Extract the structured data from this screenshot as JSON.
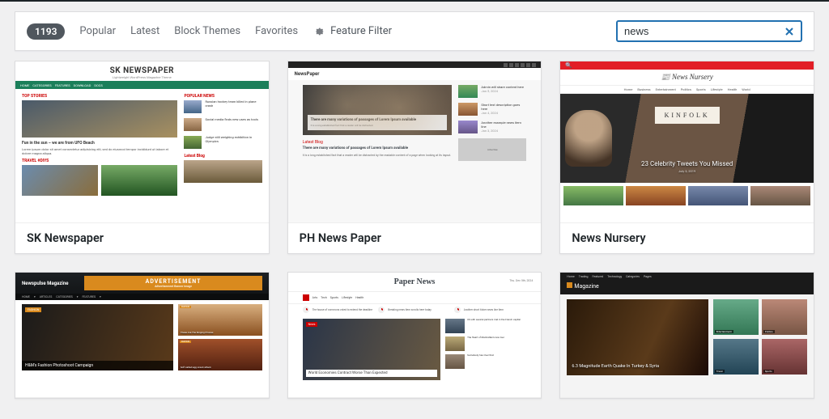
{
  "filter": {
    "count": "1193",
    "popular": "Popular",
    "latest": "Latest",
    "block_themes": "Block Themes",
    "favorites": "Favorites",
    "feature_filter": "Feature Filter"
  },
  "search": {
    "value": "news"
  },
  "themes": [
    {
      "name": "SK Newspaper"
    },
    {
      "name": "PH News Paper"
    },
    {
      "name": "News Nursery"
    },
    {
      "name": ""
    },
    {
      "name": ""
    },
    {
      "name": ""
    }
  ],
  "thumb1": {
    "logo": "SK NEWSPAPER",
    "tagline": "Lightweight WordPress Magazine Theme",
    "top_stories": "TOP STORIES",
    "headline": "Fun in the sun – we are from UFO Beach",
    "popular": "POPULAR NEWS",
    "side1": "Russian hockey team killed in plane crash",
    "side2": "Social media finds new uses as tools",
    "side3": "Judge still weighing exhibition in Olympics"
  },
  "thumb2": {
    "brand": "NewsPaper",
    "overlay_title": "There are many variations of passages of Lorem Ipsum available",
    "latest": "Latest Blog",
    "par": "There are many variations of passages of Lorem Ipsum available"
  },
  "thumb3": {
    "brand": "News Nursery",
    "nav": [
      "Home",
      "Business",
      "Entertainment",
      "Politics",
      "Sports",
      "Lifestyle",
      "Health",
      "World"
    ],
    "kinfolk": "KINFOLK",
    "caption": "23 Celebrity Tweets You Missed",
    "date": "July 3, 2019"
  },
  "thumb4": {
    "logo": "Newspulse Magazine",
    "ad": "ADVERTISEMENT",
    "adsub": "Advertisement Banner Image",
    "nav": [
      "HOME",
      "ARTICLES",
      "CATEGORIES",
      "FEATURES"
    ],
    "tag": "FASHION",
    "hero_cap": "H&M's Fashion Photoshoot Campaign",
    "r1": "These Are The Singing Phones",
    "r2": "Soft salted egg snack attack"
  },
  "thumb5": {
    "title": "Paper News",
    "date": "Thu. Dec 5th, 2024",
    "nav": [
      "Arts",
      "Tech",
      "Sports",
      "Lifestyle",
      "Health"
    ],
    "hero_tag": "News",
    "hero_cap": "World Economies Contract Worse Than Expected",
    "t1": "The house of commons voted to extend the deadline",
    "s1": "US with several partners met in the French capital",
    "s2": "The Heart of Manhattan's new tour",
    "s3": "Somebody has Over that"
  },
  "thumb6": {
    "nav": [
      "Home",
      "Trading",
      "Featured",
      "Technology",
      "Categories",
      "Pages"
    ],
    "logo": "Magazine",
    "hero": "6.3 Magnitude Earth Quake In Turkey & Syria",
    "c1": "Entertainment",
    "c2": "Politics",
    "c3": "Travel",
    "c4": "Sports"
  }
}
